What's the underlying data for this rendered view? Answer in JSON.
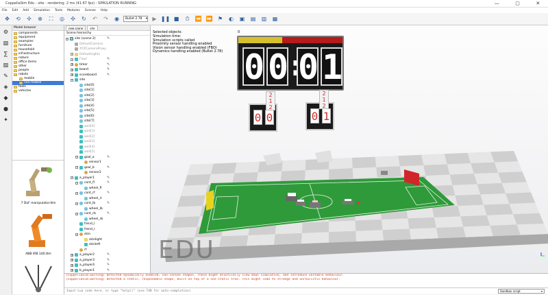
{
  "window": {
    "title": "CoppeliaSim Edu - site - rendering: 2 ms (41.67 fps) - SIMULATION RUNNING",
    "controls": [
      "—",
      "▢",
      "✕"
    ]
  },
  "menu": [
    "File",
    "Edit",
    "Add",
    "Simulation",
    "Tools",
    "Modules",
    "Scenes",
    "Help"
  ],
  "toolbar": {
    "engine_select": "Bullet 2.78",
    "engine_caret": "▾",
    "icons": [
      "move-view-icon",
      "rotate-view-icon",
      "shift-icon",
      "zoom-icon",
      "fit-icon",
      "camera-icon",
      "object-shift-icon",
      "object-rotate-icon",
      "undo-icon",
      "redo-icon",
      "dynamics-icon",
      "play-icon",
      "pause-icon",
      "stop-icon",
      "realtime-icon",
      "slower-icon",
      "faster-icon",
      "thread-icon",
      "visualize-icon",
      "page-icon",
      "scene-icon",
      "browser-icon",
      "hierarchy-icon"
    ]
  },
  "model_browser": {
    "header": "Model browser",
    "items": [
      {
        "label": "components",
        "selected": false,
        "indent": false
      },
      {
        "label": "equipment",
        "selected": false,
        "indent": false
      },
      {
        "label": "examples",
        "selected": false,
        "indent": false
      },
      {
        "label": "furniture",
        "selected": false,
        "indent": false
      },
      {
        "label": "household",
        "selected": false,
        "indent": false
      },
      {
        "label": "infrastructure",
        "selected": false,
        "indent": false
      },
      {
        "label": "nature",
        "selected": false,
        "indent": false
      },
      {
        "label": "office items",
        "selected": false,
        "indent": false
      },
      {
        "label": "other",
        "selected": false,
        "indent": false
      },
      {
        "label": "people",
        "selected": false,
        "indent": false
      },
      {
        "label": "robots",
        "selected": false,
        "indent": false
      },
      {
        "label": "mobile",
        "selected": false,
        "indent": true
      },
      {
        "label": "non-mobile",
        "selected": true,
        "indent": true
      },
      {
        "label": "tools",
        "selected": false,
        "indent": false
      },
      {
        "label": "vehicles",
        "selected": false,
        "indent": false
      }
    ],
    "thumbnails": [
      {
        "caption": "7 DoF manipulator.ttm"
      },
      {
        "caption": "ABB IRB 140.ttm"
      },
      {
        "caption": ""
      }
    ]
  },
  "scene_panel": {
    "tabs": [
      "new scene",
      "site"
    ],
    "active_tab": "site",
    "header": "Scene hierarchy",
    "items": [
      {
        "label": "site (scene 2)",
        "icon": "scene",
        "depth": 0,
        "grey": false,
        "pm": "−",
        "script": true
      },
      {
        "label": "DefaultCamera",
        "icon": "cam",
        "depth": 1,
        "grey": true,
        "pm": ""
      },
      {
        "label": "XYZCameraProxy",
        "icon": "cam",
        "depth": 1,
        "grey": true,
        "pm": ""
      },
      {
        "label": "DefaultLights",
        "icon": "light",
        "depth": 1,
        "grey": true,
        "pm": "+"
      },
      {
        "label": "Floor",
        "icon": "cube",
        "depth": 1,
        "grey": true,
        "pm": "+",
        "script": true
      },
      {
        "label": "timer",
        "icon": "dummy",
        "depth": 1,
        "grey": false,
        "pm": "+",
        "script": true
      },
      {
        "label": "board",
        "icon": "cube",
        "depth": 1,
        "grey": false,
        "pm": "+",
        "script": true
      },
      {
        "label": "scoreboard",
        "icon": "cube",
        "depth": 1,
        "grey": false,
        "pm": "+",
        "script": true
      },
      {
        "label": "site",
        "icon": "cube",
        "depth": 1,
        "grey": false,
        "pm": "−"
      },
      {
        "label": "site[0]",
        "icon": "cyl",
        "depth": 2,
        "grey": false,
        "pm": ""
      },
      {
        "label": "site[1]",
        "icon": "cyl",
        "depth": 2,
        "grey": false,
        "pm": ""
      },
      {
        "label": "site[2]",
        "icon": "cyl",
        "depth": 2,
        "grey": false,
        "pm": ""
      },
      {
        "label": "site[3]",
        "icon": "cyl",
        "depth": 2,
        "grey": false,
        "pm": ""
      },
      {
        "label": "site[4]",
        "icon": "cyl",
        "depth": 2,
        "grey": false,
        "pm": ""
      },
      {
        "label": "site[5]",
        "icon": "cyl",
        "depth": 2,
        "grey": false,
        "pm": ""
      },
      {
        "label": "site[6]",
        "icon": "cyl",
        "depth": 2,
        "grey": false,
        "pm": ""
      },
      {
        "label": "site[7]",
        "icon": "cyl",
        "depth": 2,
        "grey": false,
        "pm": ""
      },
      {
        "label": "wall[0]",
        "icon": "cube",
        "depth": 2,
        "grey": true,
        "pm": ""
      },
      {
        "label": "wall[1]",
        "icon": "cube",
        "depth": 2,
        "grey": true,
        "pm": ""
      },
      {
        "label": "wall[2]",
        "icon": "cube",
        "depth": 2,
        "grey": true,
        "pm": ""
      },
      {
        "label": "wall[3]",
        "icon": "cube",
        "depth": 2,
        "grey": true,
        "pm": ""
      },
      {
        "label": "wall[4]",
        "icon": "cube",
        "depth": 2,
        "grey": true,
        "pm": ""
      },
      {
        "label": "wall[5]",
        "icon": "cube",
        "depth": 2,
        "grey": true,
        "pm": ""
      },
      {
        "label": "goal_a",
        "icon": "cube",
        "depth": 2,
        "grey": false,
        "pm": "−",
        "script": true
      },
      {
        "label": "sensor1",
        "icon": "dummy",
        "depth": 3,
        "grey": false,
        "pm": ""
      },
      {
        "label": "goal_b",
        "icon": "cube",
        "depth": 2,
        "grey": false,
        "pm": "−",
        "script": true
      },
      {
        "label": "sensor2",
        "icon": "dummy",
        "depth": 3,
        "grey": false,
        "pm": ""
      },
      {
        "label": "a_player1",
        "icon": "cube",
        "depth": 1,
        "grey": false,
        "pm": "−",
        "script": true
      },
      {
        "label": "cont_fl",
        "icon": "cyl",
        "depth": 2,
        "grey": false,
        "pm": "−",
        "script": true
      },
      {
        "label": "wheel_fl",
        "icon": "cyl",
        "depth": 3,
        "grey": false,
        "pm": ""
      },
      {
        "label": "cont_rf",
        "icon": "cyl",
        "depth": 2,
        "grey": false,
        "pm": "−",
        "script": true
      },
      {
        "label": "wheel_rl",
        "icon": "cyl",
        "depth": 3,
        "grey": false,
        "pm": ""
      },
      {
        "label": "cont_lb",
        "icon": "cyl",
        "depth": 2,
        "grey": false,
        "pm": "−",
        "script": true
      },
      {
        "label": "wheel_lb",
        "icon": "cyl",
        "depth": 3,
        "grey": false,
        "pm": ""
      },
      {
        "label": "cont_rb",
        "icon": "cyl",
        "depth": 2,
        "grey": false,
        "pm": "−",
        "script": true
      },
      {
        "label": "wheel_rb",
        "icon": "cyl",
        "depth": 3,
        "grey": false,
        "pm": ""
      },
      {
        "label": "frend_l",
        "icon": "cube",
        "depth": 2,
        "grey": false,
        "pm": ""
      },
      {
        "label": "frend_r",
        "icon": "cube",
        "depth": 2,
        "grey": false,
        "pm": ""
      },
      {
        "label": "skin",
        "icon": "dummy",
        "depth": 2,
        "grey": false,
        "pm": "−"
      },
      {
        "label": "skinlight",
        "icon": "light",
        "depth": 3,
        "grey": false,
        "pm": ""
      },
      {
        "label": "skinleft",
        "icon": "cube",
        "depth": 3,
        "grey": false,
        "pm": ""
      },
      {
        "label": "rf",
        "icon": "dummy",
        "depth": 2,
        "grey": false,
        "pm": ""
      },
      {
        "label": "a_player2",
        "icon": "cube",
        "depth": 1,
        "grey": false,
        "pm": "+",
        "script": true
      },
      {
        "label": "a_player3",
        "icon": "cube",
        "depth": 1,
        "grey": false,
        "pm": "+",
        "script": true
      },
      {
        "label": "a_player4",
        "icon": "cube",
        "depth": 1,
        "grey": false,
        "pm": "+",
        "script": true
      },
      {
        "label": "b_player1",
        "icon": "cube",
        "depth": 1,
        "grey": false,
        "pm": "+",
        "script": true
      }
    ]
  },
  "viewport": {
    "info_selected": "Selected objects:",
    "info_selected_count": "0",
    "info_lines": [
      "Simulation time:",
      "Simulation scripts called",
      "Proximity sensor handling enabled",
      "Vision sensor handling enabled (FBO)",
      "Dynamics handling enabled (Bullet 2.78)"
    ],
    "timer_digits": [
      "0",
      "0",
      "0",
      "1"
    ],
    "score_left": [
      "0",
      "0"
    ],
    "score_right": [
      "0",
      "1"
    ],
    "score_tab_left": [
      "2",
      "1",
      "2"
    ],
    "score_tab_right": [
      "2",
      "1",
      "2"
    ],
    "watermark": "EDU",
    "colors": {
      "field": "#2f9a3a",
      "floor_light": "#e6e6e6",
      "floor_dark": "#cfcfcf",
      "goal_yellow": "#e8d21e",
      "goal_red": "#d0262a"
    }
  },
  "console": {
    "lines": [
      "[CoppeliaSim:warning] Detected dynamically enabled, non-convex shapes. These might drastically slow down simulation, and introduce unstable behaviour.",
      "[CoppeliaSim:warning] Detected a static, respondable shape, built on top of a non-static tree. This might lead to strange and unrealistic behaviour."
    ]
  },
  "command": {
    "placeholder": "Input Lua code here, or type \"help()\" (use TAB for auto-completion)",
    "sandbox": "Sandbox script",
    "sandbox_caret": "▾"
  }
}
